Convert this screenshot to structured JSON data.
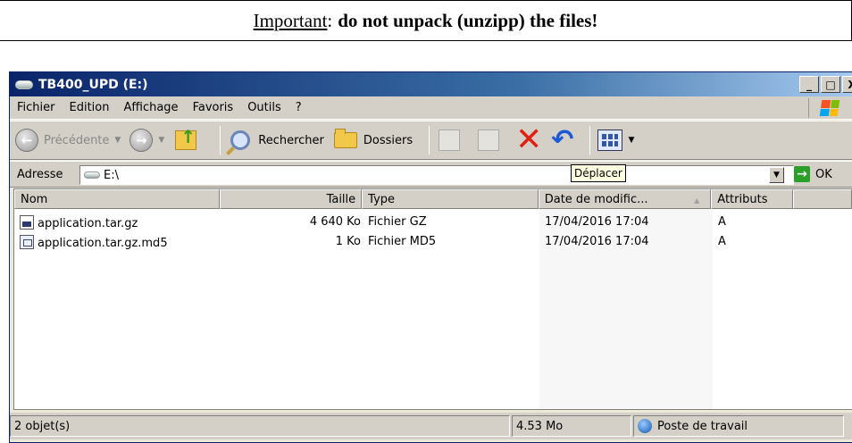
{
  "banner": {
    "label": "Important",
    "separator": ":",
    "text": "do not unpack (unzipp) the files!"
  },
  "window": {
    "title": "TB400_UPD (E:)",
    "controls": {
      "minimize": "_",
      "maximize": "□",
      "close": "X"
    }
  },
  "menu": [
    "Fichier",
    "Edition",
    "Affichage",
    "Favoris",
    "Outils",
    "?"
  ],
  "toolbar": {
    "back_label": "Précédente",
    "search_label": "Rechercher",
    "folders_label": "Dossiers",
    "tooltip": "Déplacer"
  },
  "address": {
    "label": "Adresse",
    "value": "E:\\",
    "go_label": "OK"
  },
  "columns": {
    "name": "Nom",
    "size": "Taille",
    "type": "Type",
    "date": "Date de modific...",
    "attributes": "Attributs"
  },
  "files": [
    {
      "name": "application.tar.gz",
      "size": "4 640 Ko",
      "type": "Fichier GZ",
      "date": "17/04/2016 17:04",
      "attr": "A",
      "icon": "archive-file-icon"
    },
    {
      "name": "application.tar.gz.md5",
      "size": "1 Ko",
      "type": "Fichier MD5",
      "date": "17/04/2016 17:04",
      "attr": "A",
      "icon": "md5-file-icon"
    }
  ],
  "status": {
    "count": "2 objet(s)",
    "size": "4.53 Mo",
    "location": "Poste de travail"
  },
  "colors": {
    "title_gradient_start": "#0a246a",
    "title_gradient_end": "#a6caf0",
    "chrome": "#d4d0c8",
    "delete_red": "#e02010",
    "undo_blue": "#1a5ad8"
  }
}
